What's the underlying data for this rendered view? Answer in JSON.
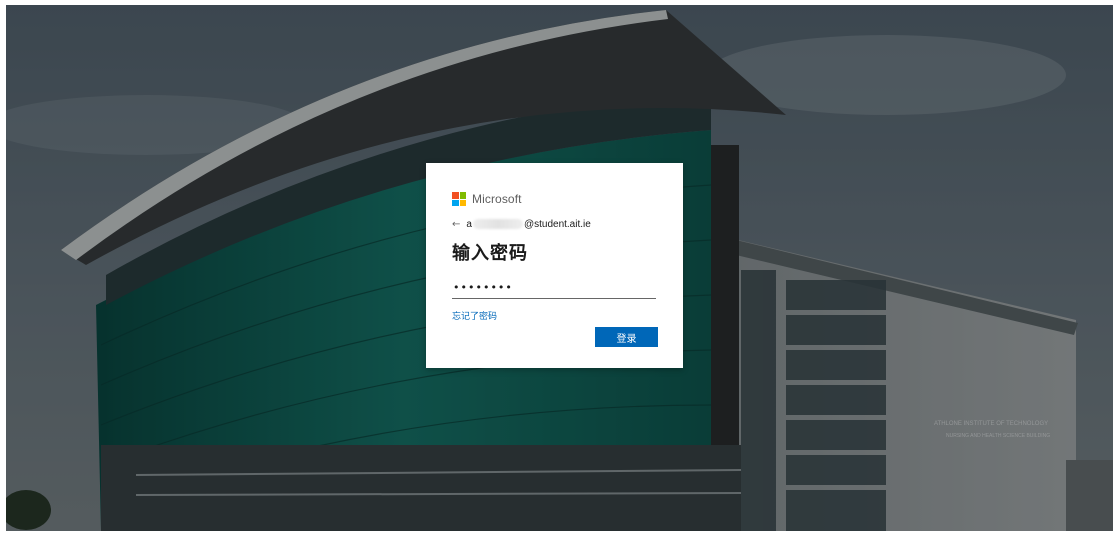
{
  "brand": {
    "name": "Microsoft",
    "logo_colors": [
      "#f25022",
      "#7fba00",
      "#00a4ef",
      "#ffb900"
    ],
    "logo_icon": "microsoft-logo-icon"
  },
  "identity": {
    "back_icon": "back-arrow-icon",
    "back_glyph": "←",
    "prefix": "a",
    "domain": "@student.ait.ie"
  },
  "login": {
    "title": "输入密码",
    "password_value": "••••••••",
    "forgot_label": "忘记了密码",
    "submit_label": "登录"
  },
  "background": {
    "description_icon": "building-photo",
    "building_sign_line1": "ATHLONE INSTITUTE OF TECHNOLOGY",
    "building_sign_line2": "NURSING AND HEALTH SCIENCE BUILDING"
  },
  "colors": {
    "accent": "#0067b8",
    "text": "#1b1b1b"
  }
}
